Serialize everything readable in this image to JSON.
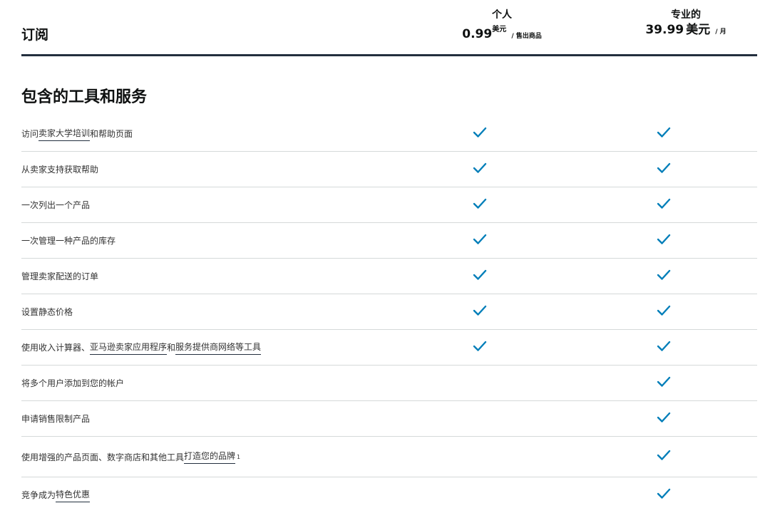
{
  "header": {
    "title": "订阅",
    "plans": [
      {
        "name": "个人",
        "price": "0.99",
        "currency": "美元",
        "unit": "/ 售出商品"
      },
      {
        "name": "专业的",
        "price": "39.99",
        "currency": "美元",
        "unit": "/ 月"
      }
    ]
  },
  "section": {
    "title": "包含的工具和服务"
  },
  "features": [
    {
      "parts": [
        {
          "text": "访问"
        },
        {
          "text": "卖家大学培训",
          "link": true
        },
        {
          "text": "和帮助页面"
        }
      ],
      "individual": true,
      "professional": true
    },
    {
      "parts": [
        {
          "text": "从卖家支持获取帮助"
        }
      ],
      "individual": true,
      "professional": true
    },
    {
      "parts": [
        {
          "text": "一次列出一个产品"
        }
      ],
      "individual": true,
      "professional": true
    },
    {
      "parts": [
        {
          "text": "一次管理一种产品的库存"
        }
      ],
      "individual": true,
      "professional": true
    },
    {
      "parts": [
        {
          "text": "管理卖家配送的订单"
        }
      ],
      "individual": true,
      "professional": true
    },
    {
      "parts": [
        {
          "text": "设置静态价格"
        }
      ],
      "individual": true,
      "professional": true
    },
    {
      "parts": [
        {
          "text": "使用收入计算器、"
        },
        {
          "text": "亚马逊卖家应用程序",
          "link": true
        },
        {
          "text": "和"
        },
        {
          "text": "服务提供商网络等工具",
          "link": true
        }
      ],
      "individual": true,
      "professional": true
    },
    {
      "parts": [
        {
          "text": "将多个用户添加到您的帐户"
        }
      ],
      "individual": false,
      "professional": true
    },
    {
      "parts": [
        {
          "text": "申请销售限制产品"
        }
      ],
      "individual": false,
      "professional": true
    },
    {
      "parts": [
        {
          "text": "使用增强的产品页面、数字商店和其他工具"
        },
        {
          "text": "打造您的品牌",
          "link": true
        },
        {
          "text": "1",
          "note": true
        }
      ],
      "individual": false,
      "professional": true,
      "tall": true
    },
    {
      "parts": [
        {
          "text": "竞争成为"
        },
        {
          "text": "特色优惠",
          "link": true
        }
      ],
      "individual": false,
      "professional": true
    }
  ],
  "colors": {
    "check": "#007eb9",
    "divider": "#d5d9d9",
    "header_rule": "#232f3e"
  },
  "icons": {
    "included": "checkmark-icon"
  }
}
